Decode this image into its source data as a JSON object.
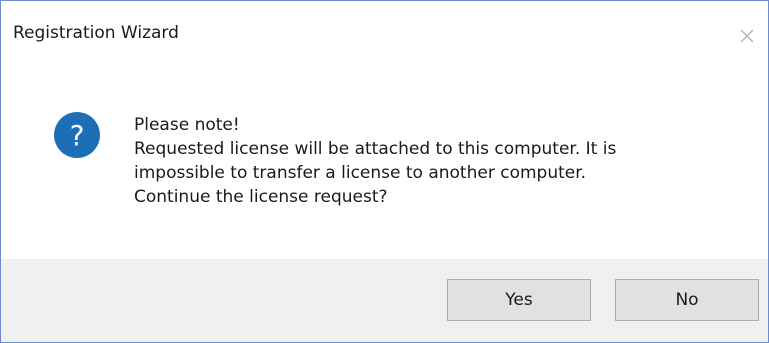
{
  "window": {
    "title": "Registration Wizard",
    "close_icon": "close-icon"
  },
  "message": {
    "icon": "question-icon",
    "lines": [
      "Please note!",
      "Requested license will be attached to this computer. It is",
      "impossible to transfer a license to another computer.",
      "Continue the license request?"
    ]
  },
  "buttons": {
    "yes_label": "Yes",
    "no_label": "No"
  },
  "colors": {
    "icon_blue": "#1c6fb5",
    "footer_bg": "#f0f0f0",
    "button_bg": "#e1e1e1",
    "button_border": "#adadad",
    "window_border": "#6b8ccf"
  }
}
